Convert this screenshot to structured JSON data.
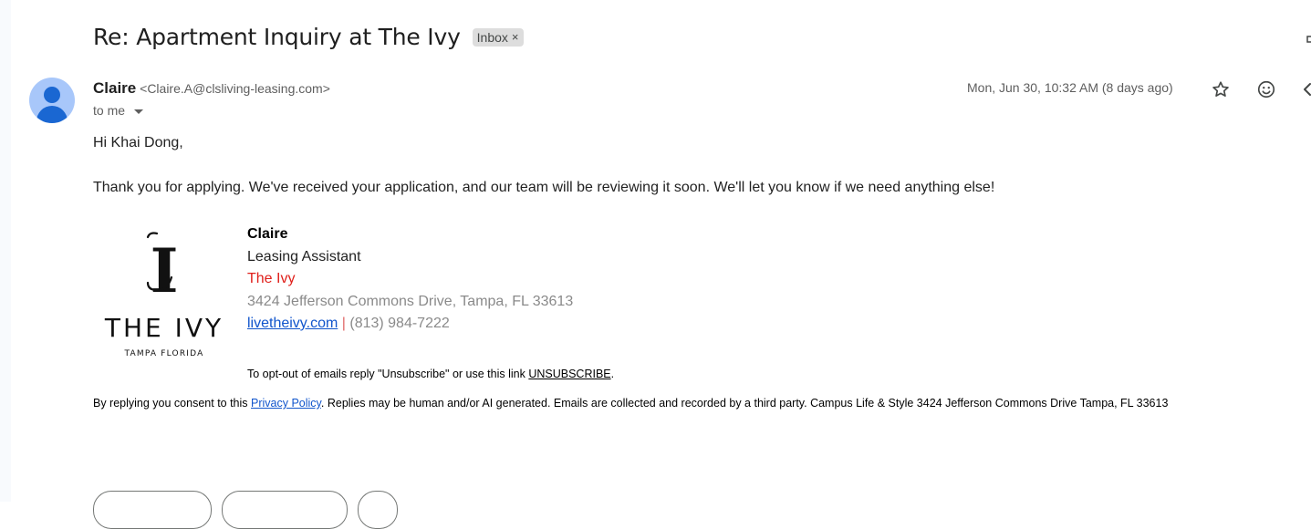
{
  "email": {
    "subject": "Re: Apartment Inquiry at The Ivy",
    "label": "Inbox",
    "label_remove": "×",
    "sender": {
      "name": "Claire",
      "email": "<Claire.A@clsliving-leasing.com>"
    },
    "to": "to me",
    "date": "Mon, Jun 30, 10:32 AM (8 days ago)",
    "greeting": "Hi Khai Dong,",
    "paragraph": "Thank you for applying. We've received your application, and our team will be reviewing it soon. We'll let you know if we need anything else!"
  },
  "signature": {
    "name": "Claire",
    "title": "Leasing Assistant",
    "company": "The Ivy",
    "address": "3424 Jefferson Commons Drive, Tampa, FL 33613",
    "website": "livetheivy.com",
    "separator": "|",
    "phone": "(813) 984-7222",
    "logo_main": "THE IVY",
    "logo_sub": "TAMPA FLORIDA",
    "logo_monogram": "I"
  },
  "footer": {
    "optout_prefix": "To opt-out of emails reply \"Unsubscribe\" or use this link ",
    "optout_link": "UNSUBSCRIBE",
    "optout_suffix": ".",
    "consent_prefix": "By replying you consent to this ",
    "consent_link": "Privacy Policy",
    "consent_suffix": ". Replies may be human and/or AI generated. Emails are collected and recorded by a third party. Campus Life & Style 3424 Jefferson Commons Drive Tampa, FL 33613"
  },
  "icons": {
    "star": "star-icon",
    "emoji": "emoji-icon",
    "reply": "reply-icon",
    "avatar": "avatar-icon",
    "dropdown": "chevron-down-icon"
  },
  "colors": {
    "link": "#1155cc",
    "brand_red": "#e0201b",
    "avatar_bg": "#a8c7fa",
    "avatar_fg": "#1a67d2"
  }
}
